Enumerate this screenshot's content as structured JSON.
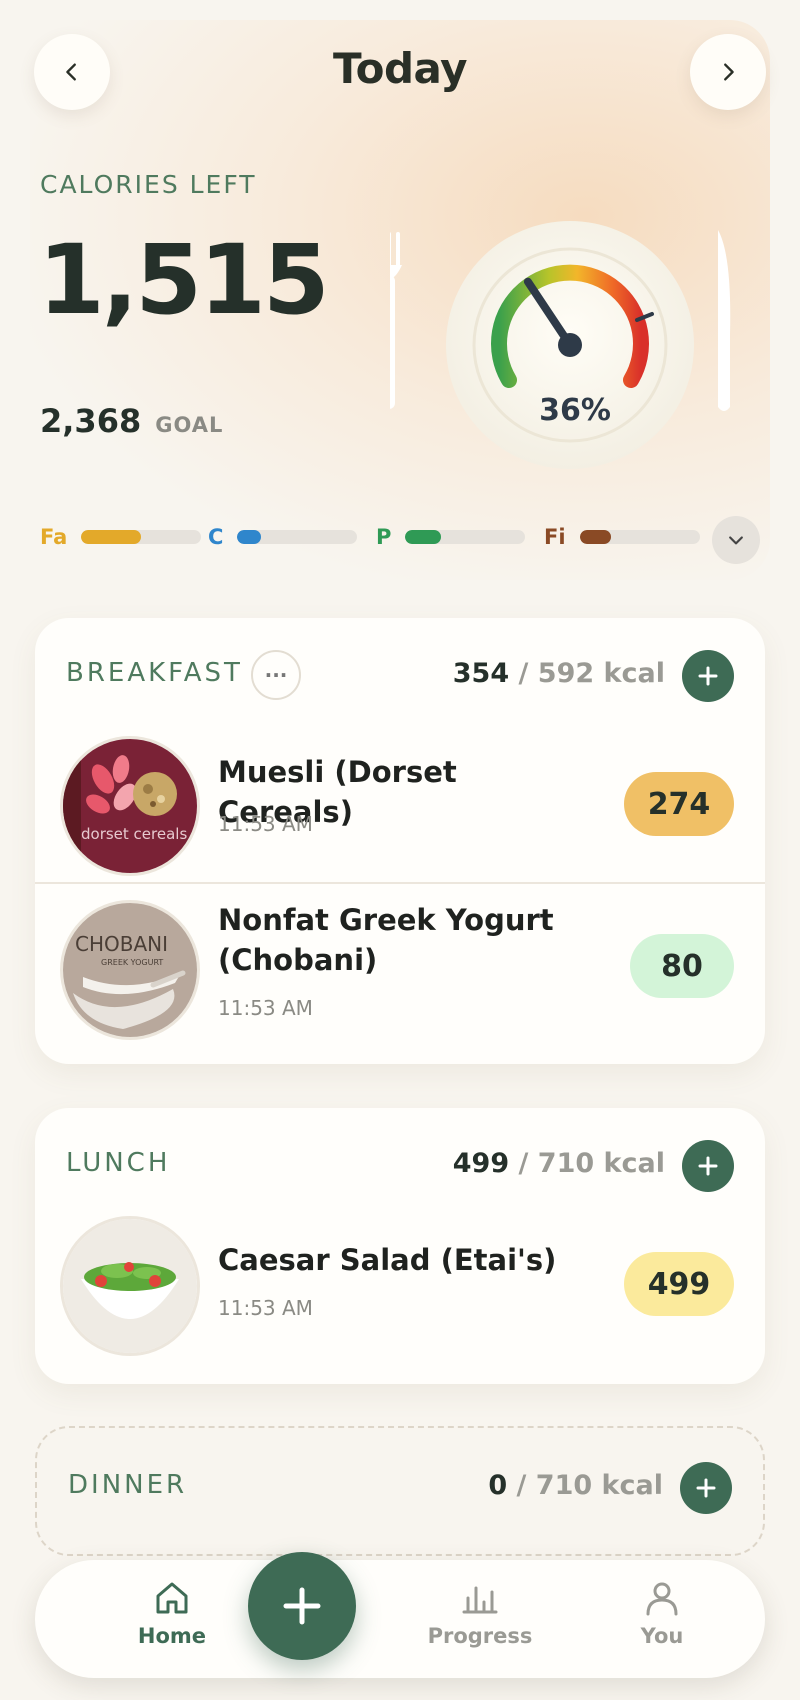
{
  "header": {
    "title": "Today",
    "prev_icon": "chevron-left-icon",
    "next_icon": "chevron-right-icon"
  },
  "summary": {
    "calories_left_label": "CALORIES LEFT",
    "calories_left_value": "1,515",
    "goal_value": "2,368",
    "goal_label": "GOAL",
    "gauge_percent_text": "36%",
    "gauge_fraction": 0.36
  },
  "macros": [
    {
      "label": "Fa",
      "color": "#e3a92a",
      "fill": 0.5
    },
    {
      "label": "C",
      "color": "#2f86cc",
      "fill": 0.2
    },
    {
      "label": "P",
      "color": "#2f9a55",
      "fill": 0.3
    },
    {
      "label": "Fi",
      "color": "#8a4a25",
      "fill": 0.26
    }
  ],
  "meals": {
    "breakfast": {
      "title": "BREAKFAST",
      "more_label": "···",
      "eaten": "354",
      "separator": " / ",
      "target": "592 kcal",
      "items": [
        {
          "name": "Muesli (Dorset Cereals)",
          "time": "11:53 AM",
          "calories": "274",
          "pill_color": "#f0c066"
        },
        {
          "name": "Nonfat Greek Yogurt (Chobani)",
          "time": "11:53 AM",
          "calories": "80",
          "pill_color": "#d3f4d8"
        }
      ]
    },
    "lunch": {
      "title": "LUNCH",
      "eaten": "499",
      "separator": " / ",
      "target": "710 kcal",
      "items": [
        {
          "name": "Caesar Salad (Etai's)",
          "time": "11:53 AM",
          "calories": "499",
          "pill_color": "#fbea9c"
        }
      ]
    },
    "dinner": {
      "title": "DINNER",
      "eaten": "0",
      "separator": " / ",
      "target": "710 kcal"
    }
  },
  "thumbnail_text": {
    "dorset": "dorset cereals",
    "chobani": "CHOBANI",
    "chobani_sub": "GREEK YOGURT"
  },
  "tabbar": {
    "home": "Home",
    "progress": "Progress",
    "you": "You"
  },
  "colors": {
    "accent": "#3e6b55",
    "label_green": "#4f7a5e"
  }
}
